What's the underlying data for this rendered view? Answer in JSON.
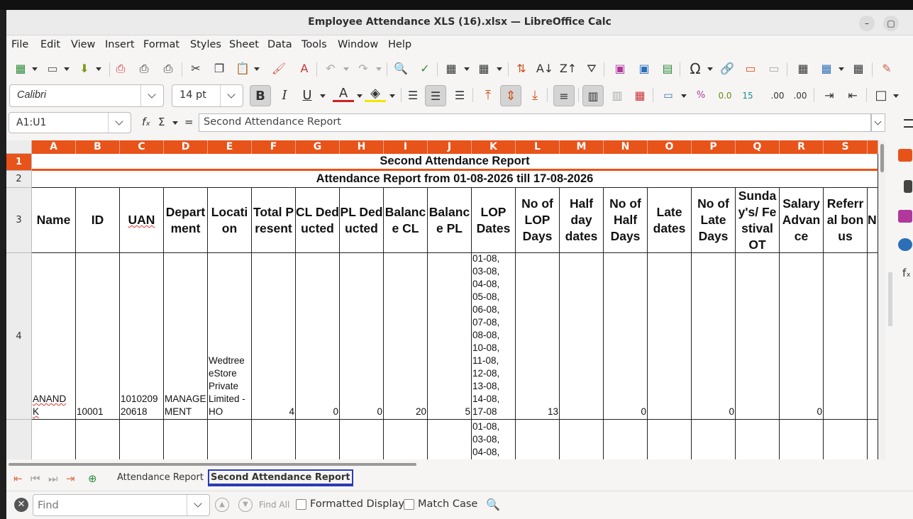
{
  "window": {
    "title": "Employee Attendance XLS (16).xlsx — LibreOffice Calc"
  },
  "menu": [
    "File",
    "Edit",
    "View",
    "Insert",
    "Format",
    "Styles",
    "Sheet",
    "Data",
    "Tools",
    "Window",
    "Help"
  ],
  "font": {
    "name": "Calibri",
    "size": "14 pt"
  },
  "formula_bar": {
    "cell_ref": "A1:U1",
    "content": "Second Attendance Report"
  },
  "columns": [
    "A",
    "B",
    "C",
    "D",
    "E",
    "F",
    "G",
    "H",
    "I",
    "J",
    "K",
    "L",
    "M",
    "N",
    "O",
    "P",
    "Q",
    "R",
    "S"
  ],
  "rows": [
    "1",
    "2",
    "3",
    "4"
  ],
  "sheet": {
    "title": "Second Attendance Report",
    "subtitle": "Attendance Report from 01-08-2026 till 17-08-2026",
    "headers": [
      "Name",
      "ID",
      "UAN",
      "Department",
      "Location",
      "Total Present",
      "CL Deducted",
      "PL Deducted",
      "Balance CL",
      "Balance PL",
      "LOP Dates",
      "No of LOP Days",
      "Half day dates",
      "No of Half Days",
      "Late dates",
      "No of Late Days",
      "Sunday's/ Festival OT",
      "Salary Advance",
      "Referral bonus"
    ],
    "row4": {
      "name": "ANAND K",
      "id": "10001",
      "uan": "101020920618",
      "department": "MANAGEMENT",
      "location": "Wedtree eStore Private Limited - HO",
      "total_present": "4",
      "cl_deducted": "0",
      "pl_deducted": "0",
      "balance_cl": "20",
      "balance_pl": "5",
      "lop_dates": [
        "01-08,",
        "03-08,",
        "04-08,",
        "05-08,",
        "06-08,",
        "07-08,",
        "08-08,",
        "10-08,",
        "11-08,",
        "12-08,",
        "13-08,",
        "14-08,",
        "17-08"
      ],
      "lop_days": "13",
      "half_days": "0",
      "late_days": "0",
      "salary_advance": "0"
    },
    "row5_lop_dates": [
      "01-08,",
      "03-08,",
      "04-08,"
    ]
  },
  "tabs": [
    "Attendance Report",
    "Second Attendance Report"
  ],
  "find": {
    "placeholder": "Find",
    "find_all": "Find All",
    "formatted_display": "Formatted Display",
    "match_case": "Match Case"
  },
  "colors": {
    "accent": "#e8531a",
    "active_tab": "#2a3bb7"
  }
}
